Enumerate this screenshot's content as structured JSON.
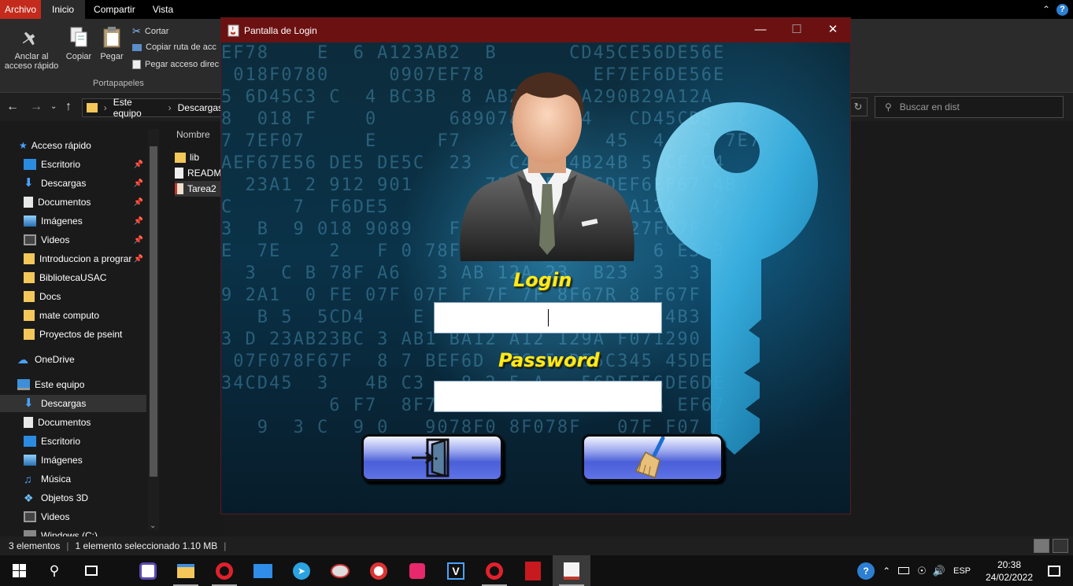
{
  "ribbon": {
    "tabs": [
      "Archivo",
      "Inicio",
      "Compartir",
      "Vista"
    ],
    "pin_label_1": "Anclar al",
    "pin_label_2": "acceso rápido",
    "copy_label": "Copiar",
    "paste_label": "Pegar",
    "cut_label": "Cortar",
    "copy_path_label": "Copiar ruta de acc",
    "paste_shortcut_label": "Pegar acceso direc",
    "group_label": "Portapapeles"
  },
  "address": {
    "crumbs": [
      "Este equipo",
      "Descargas"
    ],
    "search_placeholder": "Buscar en dist"
  },
  "nav": {
    "quick_access": "Acceso rápido",
    "quick_items": [
      "Escritorio",
      "Descargas",
      "Documentos",
      "Imágenes",
      "Videos",
      "Introduccion a prograr",
      "BibliotecaUSAC",
      "Docs",
      "mate computo",
      "Proyectos de pseint"
    ],
    "onedrive": "OneDrive",
    "this_pc": "Este equipo",
    "pc_items": [
      "Descargas",
      "Documentos",
      "Escritorio",
      "Imágenes",
      "Música",
      "Objetos 3D",
      "Videos",
      "Windows (C:)"
    ]
  },
  "files": {
    "column": "Nombre",
    "rows": [
      "lib",
      "READM",
      "Tarea2"
    ]
  },
  "status": {
    "count": "3 elementos",
    "selection": "1 elemento seleccionado  1.10 MB"
  },
  "login_window": {
    "title": "Pantalla de Login",
    "login_label": "Login",
    "password_label": "Password",
    "login_value": "",
    "password_value": ""
  },
  "taskbar": {
    "lang": "ESP",
    "time": "20:38",
    "date": "24/02/2022"
  },
  "colors": {
    "title_bar": "#6b1111",
    "label_yellow": "#ffeb1a",
    "button_blue": "#4a5fd8"
  }
}
